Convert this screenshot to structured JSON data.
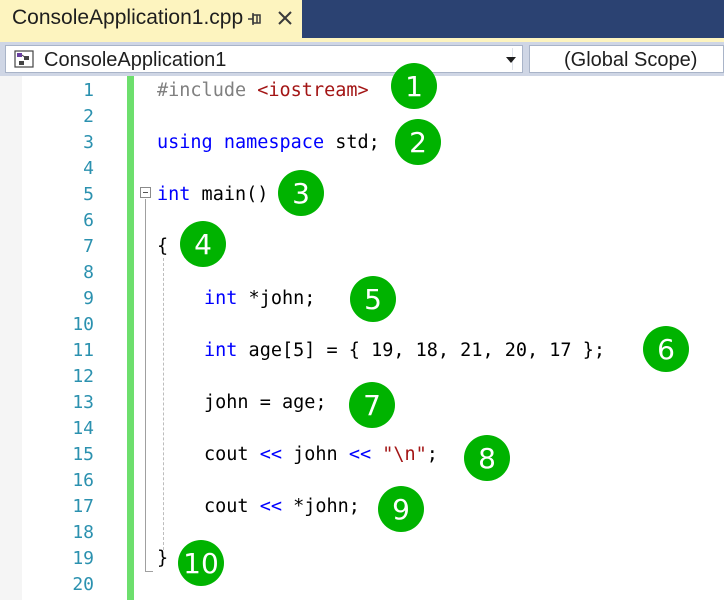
{
  "tab": {
    "title": "ConsoleApplication1.cpp",
    "icons": [
      "pin-icon",
      "close-icon"
    ]
  },
  "navbar": {
    "project": "ConsoleApplication1",
    "scope": "(Global Scope)",
    "project_icon": "project-icon",
    "dropdown_icon": "chevron-down-icon"
  },
  "colors": {
    "keyword": "#0000ff",
    "preprocessor": "#808080",
    "string": "#a31515",
    "line_number": "#2b91af",
    "callout": "#00b300",
    "change_bar": "#6ddf6d",
    "tab_active": "#fdf4bf",
    "tab_strip": "#2b4272"
  },
  "line_numbers": [
    "1",
    "2",
    "3",
    "4",
    "5",
    "6",
    "7",
    "8",
    "9",
    "10",
    "11",
    "12",
    "13",
    "14",
    "15",
    "16",
    "17",
    "18",
    "19",
    "20"
  ],
  "code": {
    "l1": {
      "a": "#include ",
      "b": "<iostream>"
    },
    "l3": {
      "a": "using",
      "b": " ",
      "c": "namespace",
      "d": " std;"
    },
    "l5": {
      "a": "int",
      "b": " main()"
    },
    "l7": {
      "a": "{"
    },
    "l9": {
      "a": "int",
      "b": " *john;"
    },
    "l11": {
      "a": "int",
      "b": " age[5] = { 19, 18, 21, 20, 17 };"
    },
    "l13": {
      "a": "john = age;"
    },
    "l15": {
      "a": "cout ",
      "b": "<<",
      "c": " john ",
      "d": "<<",
      "e": " ",
      "f": "\"\\n\"",
      "g": ";"
    },
    "l17": {
      "a": "cout ",
      "b": "<<",
      "c": " *john;"
    },
    "l19": {
      "a": "}"
    }
  },
  "callouts": [
    "1",
    "2",
    "3",
    "4",
    "5",
    "6",
    "7",
    "8",
    "9",
    "10"
  ]
}
